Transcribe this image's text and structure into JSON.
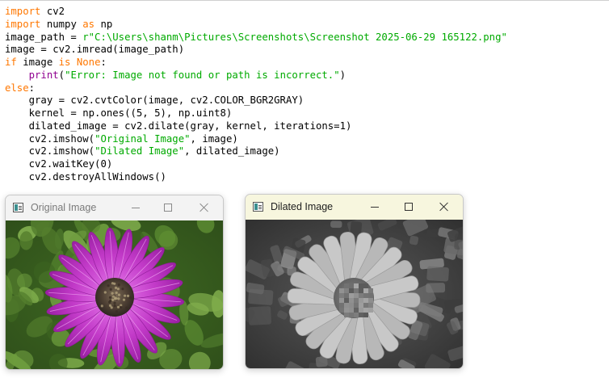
{
  "code": {
    "lines": [
      [
        {
          "t": "import",
          "c": "kw"
        },
        {
          "t": " cv2",
          "c": ""
        }
      ],
      [
        {
          "t": "import",
          "c": "kw"
        },
        {
          "t": " numpy ",
          "c": ""
        },
        {
          "t": "as",
          "c": "kw"
        },
        {
          "t": " np",
          "c": ""
        }
      ],
      [
        {
          "t": "image_path = ",
          "c": ""
        },
        {
          "t": "r\"C:\\Users\\shanm\\Pictures\\Screenshots\\Screenshot 2025-06-29 165122.png\"",
          "c": "str"
        }
      ],
      [
        {
          "t": "image = cv2.imread(image_path)",
          "c": ""
        }
      ],
      [
        {
          "t": "if",
          "c": "kw"
        },
        {
          "t": " image ",
          "c": ""
        },
        {
          "t": "is",
          "c": "kw"
        },
        {
          "t": " ",
          "c": ""
        },
        {
          "t": "None",
          "c": "kw"
        },
        {
          "t": ":",
          "c": ""
        }
      ],
      [
        {
          "t": "    ",
          "c": ""
        },
        {
          "t": "print",
          "c": "bi"
        },
        {
          "t": "(",
          "c": ""
        },
        {
          "t": "\"Error: Image not found or path is incorrect.\"",
          "c": "str"
        },
        {
          "t": ")",
          "c": ""
        }
      ],
      [
        {
          "t": "else",
          "c": "kw"
        },
        {
          "t": ":",
          "c": ""
        }
      ],
      [
        {
          "t": "    gray = cv2.cvtColor(image, cv2.COLOR_BGR2GRAY)",
          "c": ""
        }
      ],
      [
        {
          "t": "    kernel = np.ones((5, 5), np.uint8)",
          "c": ""
        }
      ],
      [
        {
          "t": "    dilated_image = cv2.dilate(gray, kernel, iterations=1)",
          "c": ""
        }
      ],
      [
        {
          "t": "    cv2.imshow(",
          "c": ""
        },
        {
          "t": "\"Original Image\"",
          "c": "str"
        },
        {
          "t": ", image)",
          "c": ""
        }
      ],
      [
        {
          "t": "    cv2.imshow(",
          "c": ""
        },
        {
          "t": "\"Dilated Image\"",
          "c": "str"
        },
        {
          "t": ", dilated_image)",
          "c": ""
        }
      ],
      [
        {
          "t": "    cv2.waitKey(0)",
          "c": ""
        }
      ],
      [
        {
          "t": "    cv2.destroyAllWindows()",
          "c": ""
        }
      ]
    ]
  },
  "colors": {
    "keyword": "#ff7700",
    "string": "#00aa00",
    "builtin": "#900090",
    "petal_purple": "#c23ac8",
    "flower_center": "#5a4a3a",
    "foliage_green": "#4f7a2c"
  },
  "windows": {
    "original": {
      "title": "Original Image",
      "icon": "opencv-window-icon",
      "controls": [
        "minimize-icon",
        "maximize-icon",
        "close-icon"
      ]
    },
    "dilated": {
      "title": "Dilated Image",
      "icon": "opencv-window-icon",
      "controls": [
        "minimize-icon",
        "maximize-icon",
        "close-icon"
      ]
    }
  }
}
